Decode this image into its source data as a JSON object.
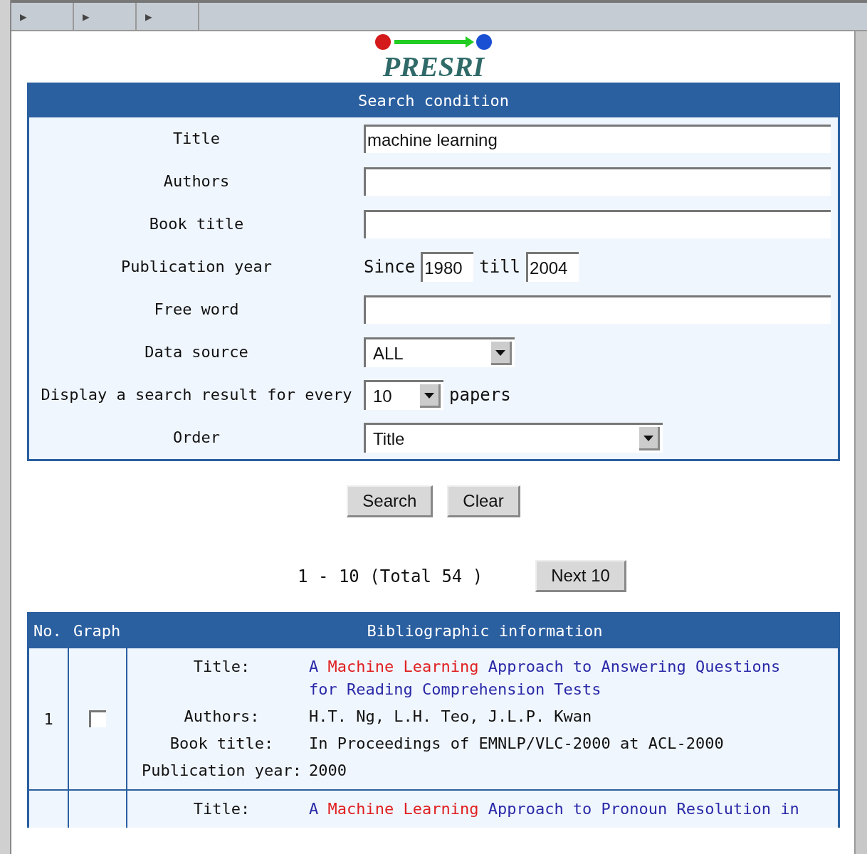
{
  "browser_tabs": [
    {
      "label": "▶"
    },
    {
      "label": "▶"
    },
    {
      "label": "▶"
    }
  ],
  "logo": {
    "text": "PRESRI"
  },
  "search_form": {
    "header": "Search condition",
    "rows": [
      {
        "kind": "text",
        "label": "Title",
        "value": "machine learning"
      },
      {
        "kind": "text",
        "label": "Authors",
        "value": ""
      },
      {
        "kind": "text",
        "label": "Book title",
        "value": ""
      },
      {
        "kind": "range",
        "label": "Publication year",
        "since_label": "Since",
        "since": "1980",
        "till_label": "till",
        "till": "2004"
      },
      {
        "kind": "text",
        "label": "Free word",
        "value": ""
      },
      {
        "kind": "select",
        "label": "Data source",
        "value": "ALL"
      },
      {
        "kind": "select",
        "label": "Display a search result for every",
        "value": "10",
        "suffix": "papers"
      },
      {
        "kind": "select",
        "label": "Order",
        "value": "Title"
      }
    ]
  },
  "buttons": [
    {
      "label": "Search"
    },
    {
      "label": "Clear"
    }
  ],
  "pager": {
    "range": "1 - 10 (Total 54 )",
    "next": "Next 10"
  },
  "results": {
    "columns": [
      "No.",
      "Graph",
      "Bibliographic information"
    ],
    "rows": [
      {
        "no": "1",
        "checked": false,
        "fields": [
          {
            "label": "Title:",
            "segments": [
              {
                "text": "A ",
                "highlight": false
              },
              {
                "text": "Machine Learning",
                "highlight": true
              },
              {
                "text": " Approach to Answering Questions for Reading Comprehension Tests",
                "highlight": false
              }
            ]
          },
          {
            "label": "Authors:",
            "value": "H.T. Ng, L.H. Teo, J.L.P. Kwan"
          },
          {
            "label": "Book title:",
            "value": "In Proceedings of EMNLP/VLC-2000 at ACL-2000"
          },
          {
            "label": "Publication year:",
            "value": "2000"
          }
        ]
      },
      {
        "fields": [
          {
            "label": "Title:",
            "segments": [
              {
                "text": "A ",
                "highlight": false
              },
              {
                "text": "Machine Learning",
                "highlight": true
              },
              {
                "text": " Approach to Pronoun Resolution in",
                "highlight": false
              }
            ]
          }
        ]
      }
    ]
  }
}
